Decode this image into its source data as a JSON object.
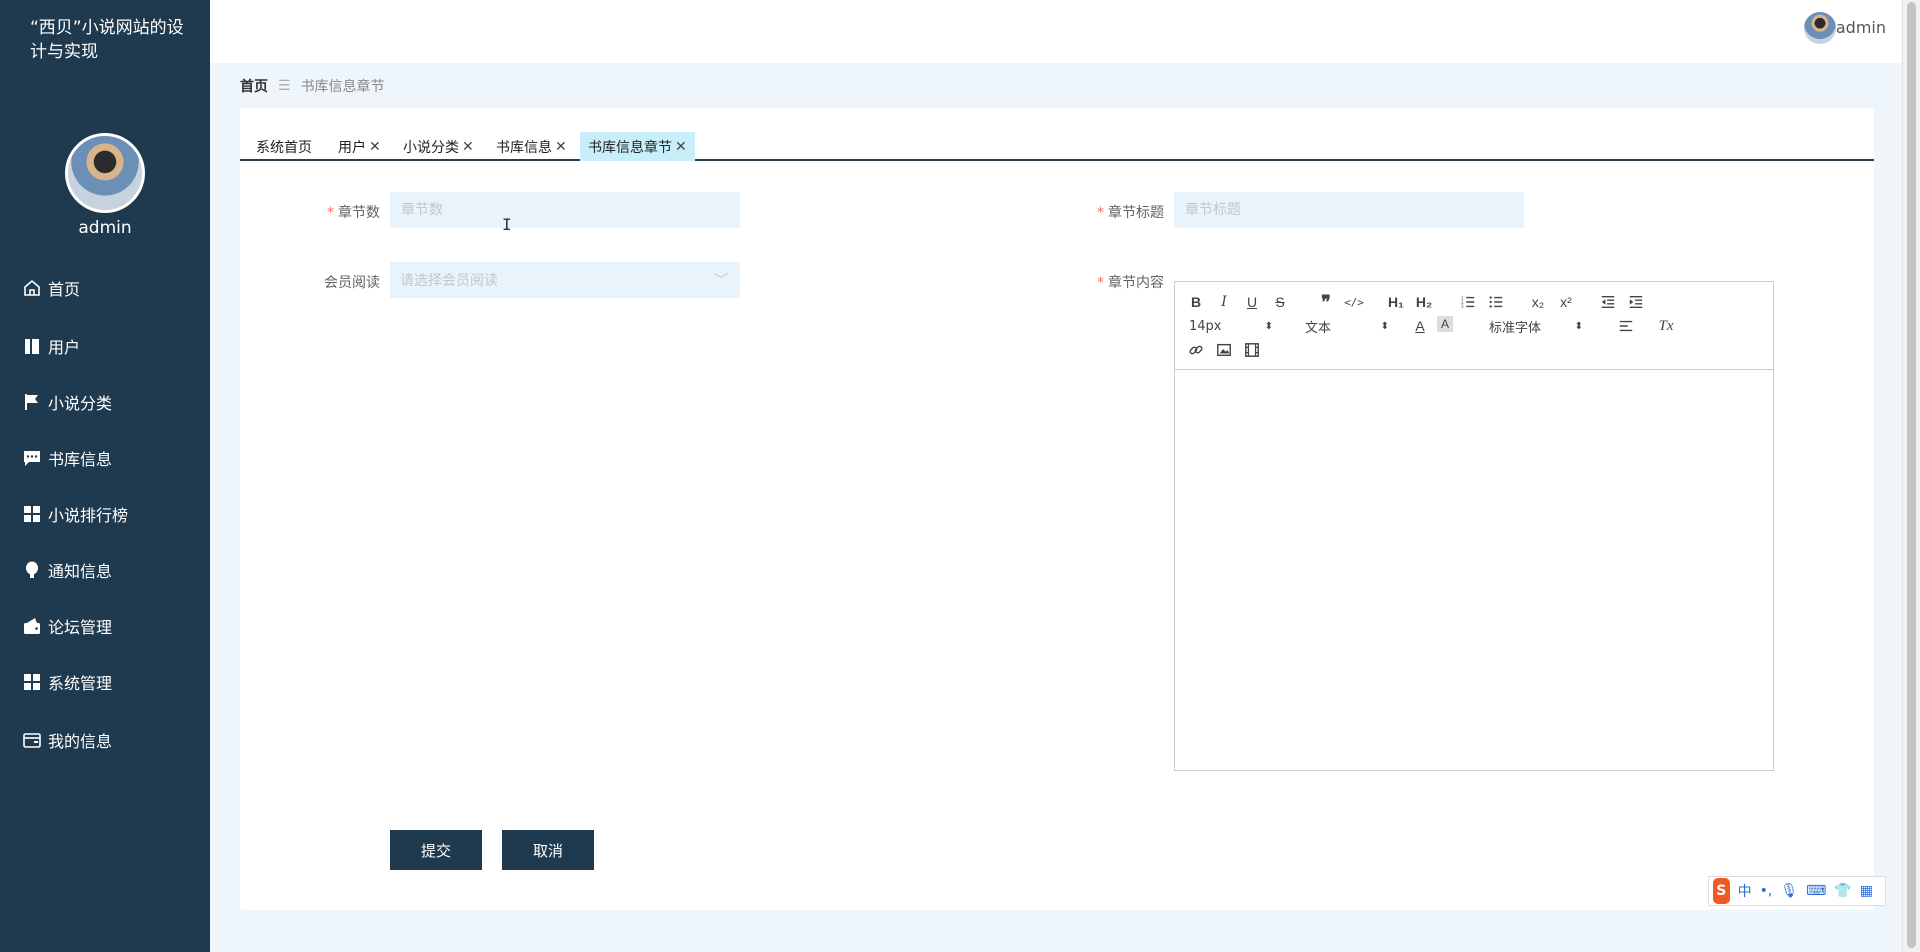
{
  "sidebar": {
    "site_title": "“西贝”小说网站的设计与实现",
    "user_name": "admin",
    "items": [
      {
        "label": "首页",
        "icon": "home-icon"
      },
      {
        "label": "用户",
        "icon": "book-icon"
      },
      {
        "label": "小说分类",
        "icon": "flag-icon"
      },
      {
        "label": "书库信息",
        "icon": "chat-icon"
      },
      {
        "label": "小说排行榜",
        "icon": "grid-icon"
      },
      {
        "label": "通知信息",
        "icon": "bulb-icon"
      },
      {
        "label": "论坛管理",
        "icon": "wallet-icon"
      },
      {
        "label": "系统管理",
        "icon": "grid-icon"
      },
      {
        "label": "我的信息",
        "icon": "card-icon"
      }
    ]
  },
  "header": {
    "user_name": "admin"
  },
  "breadcrumb": {
    "home": "首页",
    "separator": "☰",
    "current": "书库信息章节"
  },
  "tabs": [
    {
      "label": "系统首页",
      "closable": false
    },
    {
      "label": "用户",
      "closable": true
    },
    {
      "label": "小说分类",
      "closable": true
    },
    {
      "label": "书库信息",
      "closable": true
    },
    {
      "label": "书库信息章节",
      "closable": true,
      "active": true
    }
  ],
  "form": {
    "chapter_number": {
      "label": "章节数",
      "required": true,
      "placeholder": "章节数",
      "value": ""
    },
    "chapter_title": {
      "label": "章节标题",
      "required": true,
      "placeholder": "章节标题",
      "value": ""
    },
    "member_read": {
      "label": "会员阅读",
      "required": false,
      "placeholder": "请选择会员阅读"
    },
    "chapter_content": {
      "label": "章节内容",
      "required": true
    },
    "editor_toolbar": {
      "font_size": "14px",
      "header_select": "文本",
      "font_family": "标准字体",
      "h1": "H₁",
      "h2": "H₂",
      "sub": "x₂",
      "sup": "x²",
      "clean": "Tx"
    },
    "submit_label": "提交",
    "cancel_label": "取消"
  },
  "ime": {
    "logo": "S",
    "mode": "中"
  },
  "colors": {
    "sidebar_bg": "#1f3a4f",
    "active_tab": "#c7eef9",
    "input_bg": "#e9f3fb",
    "required": "#f56c6c"
  }
}
